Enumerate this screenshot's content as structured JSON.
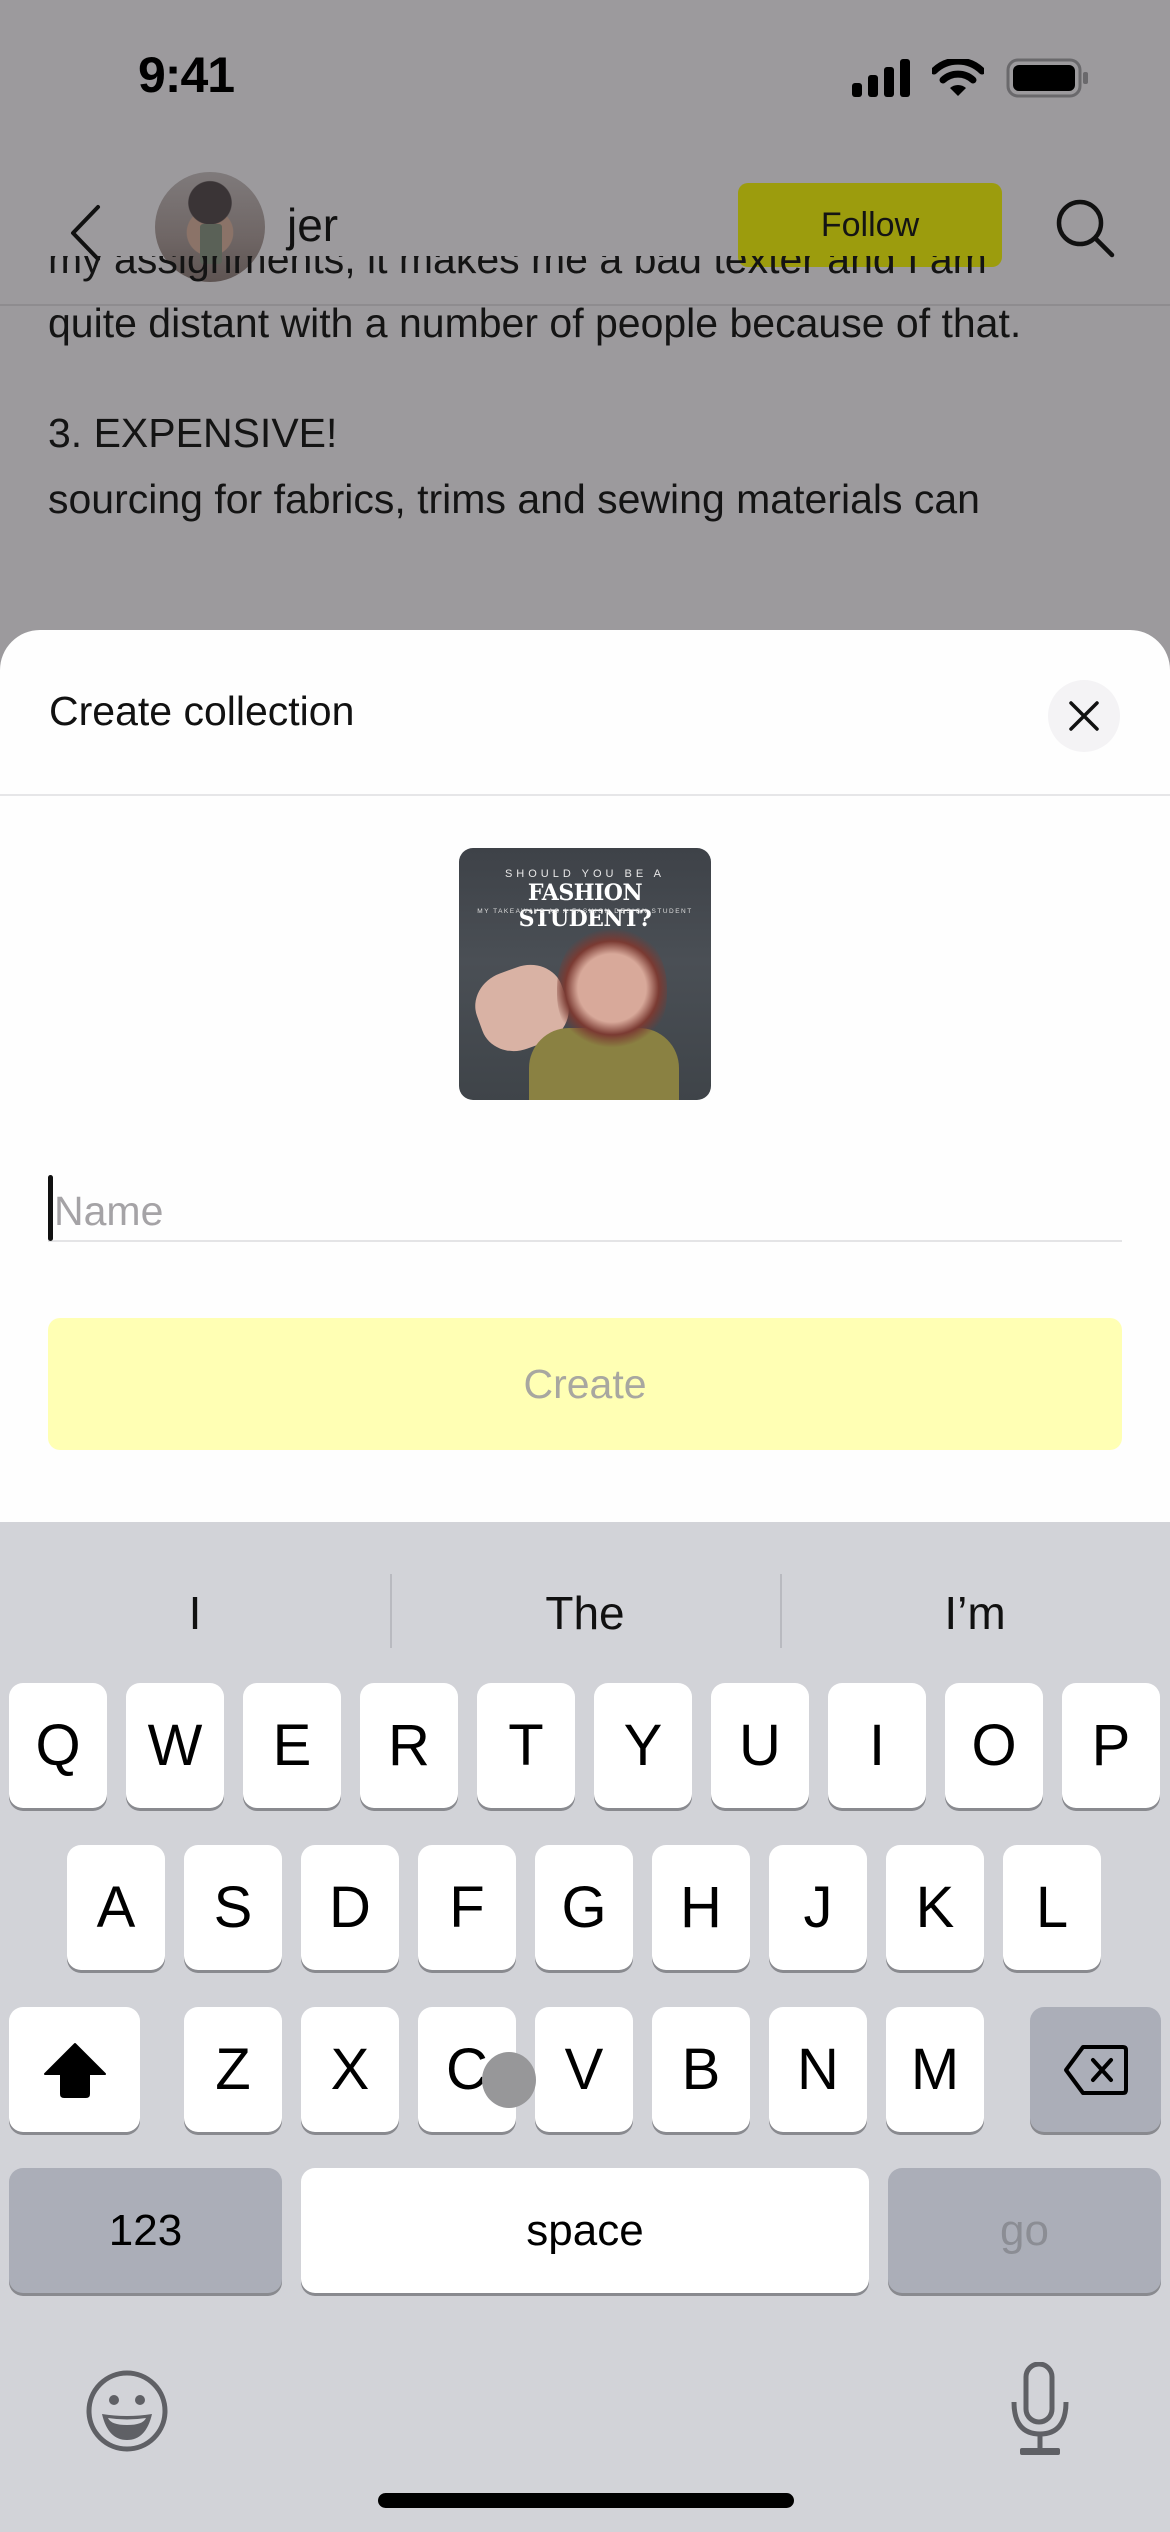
{
  "status_bar": {
    "time": "9:41",
    "icons": [
      "cellular-signal-icon",
      "wifi-icon",
      "battery-icon"
    ]
  },
  "nav_bar": {
    "back_icon": "chevron-left-icon",
    "username": "jer",
    "follow_label": "Follow",
    "search_icon": "search-icon",
    "follow_color": "#9c9c0d"
  },
  "article": {
    "cut_line": "my assignments, it makes me a bad texter and I am",
    "paragraph_1": "quite distant with a number of people because of that.",
    "heading_3": "3. EXPENSIVE!",
    "paragraph_2": "sourcing for fabrics, trims and sewing materials can"
  },
  "sheet": {
    "title": "Create collection",
    "close_icon": "close-icon",
    "cover": {
      "line1": "SHOULD YOU BE A",
      "line2": "FASHION STUDENT?",
      "line3": "MY TAKEAWAYS AS A FASHION DESIGN STUDENT"
    },
    "name_input": {
      "value": "",
      "placeholder": "Name"
    },
    "create_label": "Create",
    "create_color": "#ffffb4"
  },
  "keyboard": {
    "suggestions": [
      "I",
      "The",
      "I’m"
    ],
    "row1": [
      "Q",
      "W",
      "E",
      "R",
      "T",
      "Y",
      "U",
      "I",
      "O",
      "P"
    ],
    "row2": [
      "A",
      "S",
      "D",
      "F",
      "G",
      "H",
      "J",
      "K",
      "L"
    ],
    "row3": [
      "Z",
      "X",
      "C",
      "V",
      "B",
      "N",
      "M"
    ],
    "shift_icon": "shift-icon",
    "delete_icon": "delete-backspace-icon",
    "numbers_label": "123",
    "space_label": "space",
    "go_label": "go",
    "emoji_icon": "emoji-icon",
    "mic_icon": "microphone-icon"
  }
}
